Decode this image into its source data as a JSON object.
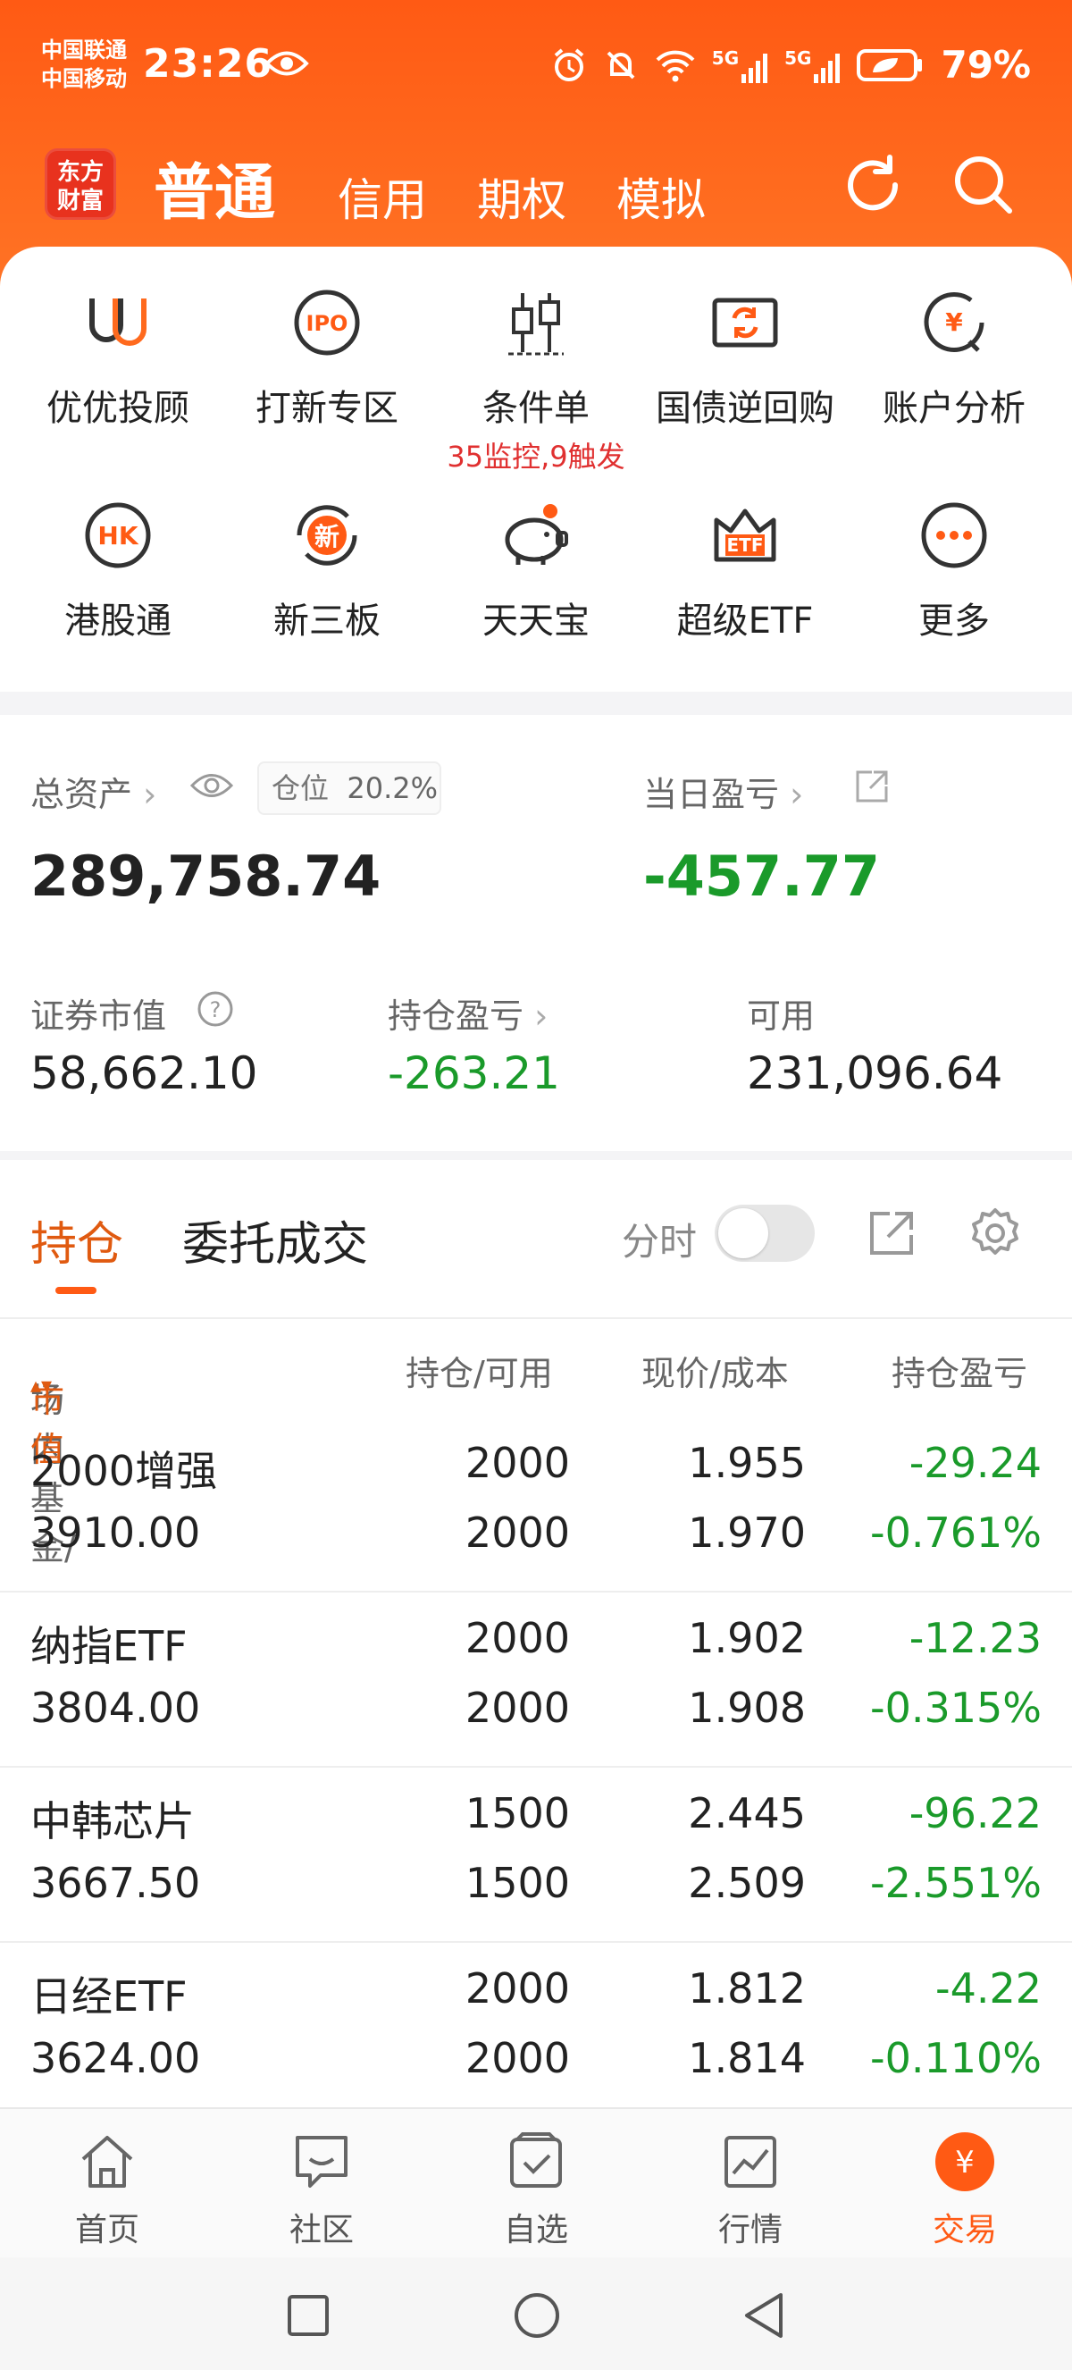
{
  "status_bar": {
    "carrier_1": "中国联通",
    "carrier_2": "中国移动",
    "time": "23:26",
    "signal_1": "5G",
    "signal_2": "5G",
    "battery": "79%"
  },
  "header": {
    "logo_line1": "东方",
    "logo_line2": "财富",
    "tabs": [
      "普通",
      "信用",
      "期权",
      "模拟"
    ],
    "active_tab": "普通"
  },
  "shortcuts": [
    {
      "label": "优优投顾",
      "icon": "advisor-icon"
    },
    {
      "label": "打新专区",
      "icon": "ipo-icon",
      "badge": "IPO"
    },
    {
      "label": "条件单",
      "icon": "candlestick-icon",
      "note": "35监控,9触发"
    },
    {
      "label": "国债逆回购",
      "icon": "bond-repo-icon"
    },
    {
      "label": "账户分析",
      "icon": "account-analysis-icon",
      "badge": "¥"
    },
    {
      "label": "港股通",
      "icon": "hk-icon",
      "badge": "HK"
    },
    {
      "label": "新三板",
      "icon": "new-third-board-icon",
      "badge": "新"
    },
    {
      "label": "天天宝",
      "icon": "piggy-bank-icon"
    },
    {
      "label": "超级ETF",
      "icon": "etf-icon",
      "badge": "ETF"
    },
    {
      "label": "更多",
      "icon": "more-icon"
    }
  ],
  "assets": {
    "total_label": "总资产",
    "total_value": "289,758.74",
    "position_label": "仓位",
    "position_value": "20.2%",
    "daily_label": "当日盈亏",
    "daily_value": "-457.77",
    "market_label": "证券市值",
    "market_value": "58,662.10",
    "holding_pl_label": "持仓盈亏",
    "holding_pl_value": "-263.21",
    "available_label": "可用",
    "available_value": "231,096.64"
  },
  "holdings": {
    "tab_positions": "持仓",
    "tab_orders": "委托成交",
    "toggle_label": "分时",
    "columns": {
      "name_part1": "场内基金/",
      "name_part2": "市值",
      "qty": "持仓/可用",
      "price": "现价/成本",
      "pl": "持仓盈亏"
    },
    "rows": [
      {
        "name": "2000增强",
        "market": "3910.00",
        "qty": "2000",
        "avail": "2000",
        "price": "1.955",
        "cost": "1.970",
        "pl": "-29.24",
        "pl_pct": "-0.761%"
      },
      {
        "name": "纳指ETF",
        "market": "3804.00",
        "qty": "2000",
        "avail": "2000",
        "price": "1.902",
        "cost": "1.908",
        "pl": "-12.23",
        "pl_pct": "-0.315%"
      },
      {
        "name": "中韩芯片",
        "market": "3667.50",
        "qty": "1500",
        "avail": "1500",
        "price": "2.445",
        "cost": "2.509",
        "pl": "-96.22",
        "pl_pct": "-2.551%"
      },
      {
        "name": "日经ETF",
        "market": "3624.00",
        "qty": "2000",
        "avail": "2000",
        "price": "1.812",
        "cost": "1.814",
        "pl": "-4.22",
        "pl_pct": "-0.110%"
      }
    ]
  },
  "bottom_nav": [
    {
      "label": "首页",
      "icon": "home-icon"
    },
    {
      "label": "社区",
      "icon": "community-icon"
    },
    {
      "label": "自选",
      "icon": "watchlist-icon"
    },
    {
      "label": "行情",
      "icon": "market-icon"
    },
    {
      "label": "交易",
      "icon": "trade-icon",
      "badge": "¥"
    }
  ],
  "colors": {
    "brand_orange": "#ff5a14",
    "loss_green": "#1a9a2a",
    "alert_red": "#e03030"
  }
}
